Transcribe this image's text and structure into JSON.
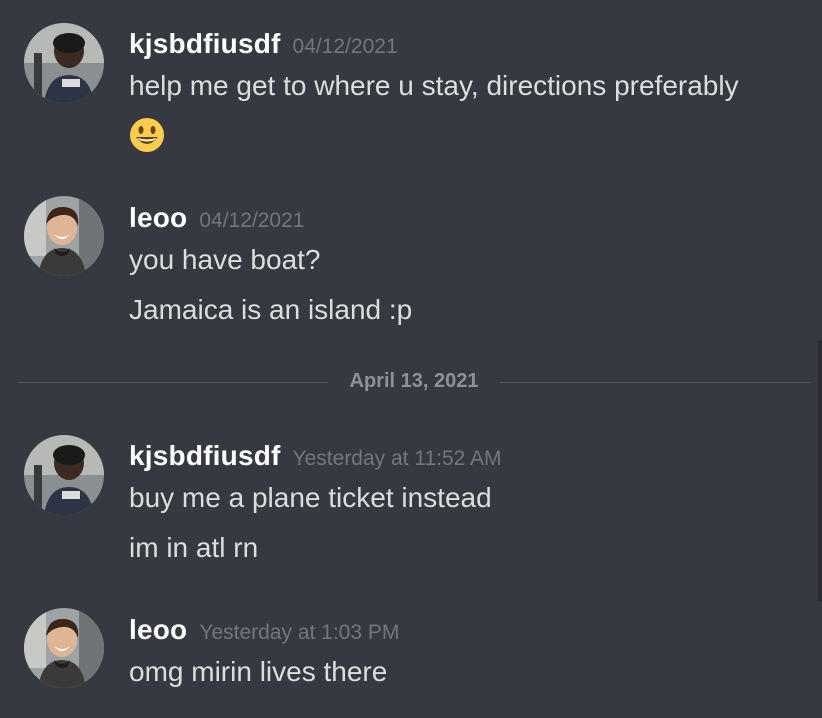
{
  "messages": [
    {
      "username": "kjsbdfiusdf",
      "timestamp": "04/12/2021",
      "lines": [
        "help me get to where u stay, directions preferably"
      ],
      "emoji": "smiley-emoji"
    },
    {
      "username": "leoo",
      "timestamp": "04/12/2021",
      "lines": [
        "you have boat?",
        "Jamaica is an island :p"
      ]
    },
    {
      "username": "kjsbdfiusdf",
      "timestamp": "Yesterday at 11:52 AM",
      "lines": [
        "buy me  a plane ticket instead",
        "im in atl rn"
      ]
    },
    {
      "username": "leoo",
      "timestamp": "Yesterday at 1:03 PM",
      "lines": [
        "omg mirin lives there"
      ]
    }
  ],
  "divider": {
    "date": "April 13, 2021"
  },
  "colors": {
    "background": "#36393f",
    "username": "#ffffff",
    "message_text": "#dcddde",
    "timestamp": "#72767d",
    "divider_text": "#8e9297"
  }
}
